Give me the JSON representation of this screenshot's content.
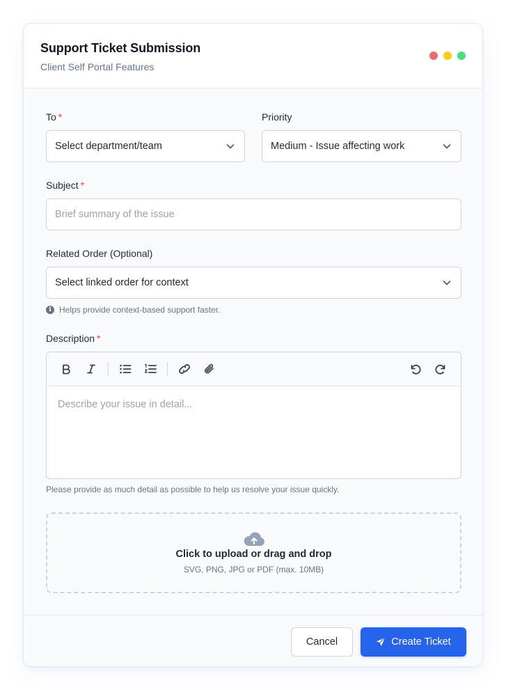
{
  "header": {
    "title": "Support Ticket Submission",
    "subtitle": "Client Self Portal Features",
    "window_dots": [
      "#ef6b6b",
      "#facc15",
      "#4ade80"
    ]
  },
  "form": {
    "to": {
      "label": "To",
      "required_mark": "*",
      "value": "Select department/team"
    },
    "priority": {
      "label": "Priority",
      "value": "Medium - Issue affecting work"
    },
    "subject": {
      "label": "Subject",
      "required_mark": "*",
      "placeholder": "Brief summary of the issue"
    },
    "related_order": {
      "label": "Related Order (Optional)",
      "value": "Select linked order for context",
      "hint": "Helps provide context-based support faster.",
      "hint_icon": "info-icon"
    },
    "description": {
      "label": "Description",
      "required_mark": "*",
      "placeholder": "Describe your issue in detail...",
      "helper": "Please provide as much detail as possible to help us resolve your issue quickly.",
      "toolbar": [
        "bold-icon",
        "italic-icon",
        "bullet-list-icon",
        "numbered-list-icon",
        "link-icon",
        "attachment-icon",
        "undo-icon",
        "redo-icon"
      ]
    },
    "upload": {
      "title": "Click to upload or drag and drop",
      "subtitle": "SVG, PNG, JPG or PDF (max. 10MB)",
      "icon": "cloud-upload-icon"
    }
  },
  "footer": {
    "cancel_label": "Cancel",
    "create_label": "Create Ticket",
    "create_icon": "send-icon"
  },
  "colors": {
    "accent": "#2563eb",
    "required": "#ef4444",
    "border": "#cbd5e1"
  }
}
